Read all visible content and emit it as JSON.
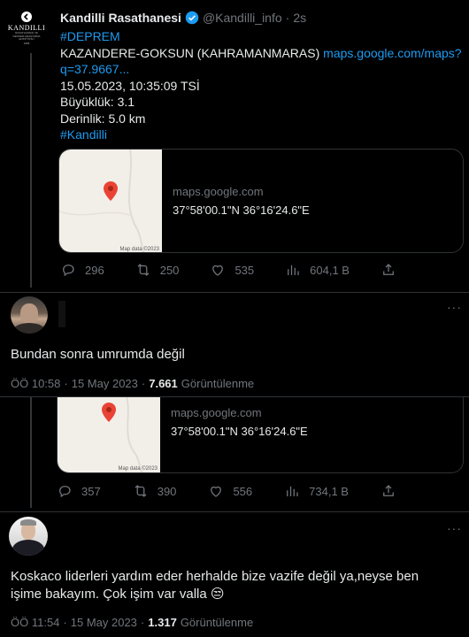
{
  "tweet1": {
    "display_name": "Kandilli Rasathanesi",
    "handle": "@Kandilli_info",
    "sep": "·",
    "time": "2s",
    "logo_text": "KANDILLI",
    "logo_subtext": "RASATHANESİ VE DEPREM ARAŞTIRMA ENSTİTÜSÜ",
    "logo_year": "1868",
    "hashtag1": "#DEPREM",
    "line_location": "KAZANDERE-GOKSUN (KAHRAMANMARAS)",
    "line_location_link": "maps.google.com/maps?",
    "line_link_cont": "q=37.9667...",
    "line_datetime": "15.05.2023, 10:35:09 TSİ",
    "line_magnitude": "Büyüklük: 3.1",
    "line_depth": "Derinlik: 5.0 km",
    "hashtag2": "#Kandilli",
    "card": {
      "domain": "maps.google.com",
      "coords": "37°58'00.1\"N 36°16'24.6\"E",
      "map_credit": "Map data ©2023"
    },
    "actions": {
      "reply": "296",
      "retweet": "250",
      "like": "535",
      "views": "604,1 B"
    }
  },
  "reply1": {
    "text": "Bundan sonra umrumda değil",
    "time": "ÖÖ 10:58",
    "dot": "·",
    "date": "15 May 2023",
    "views": "7.661",
    "views_label": "Görüntülenme",
    "more": "···"
  },
  "tweet2": {
    "card": {
      "domain": "maps.google.com",
      "coords": "37°58'00.1\"N 36°16'24.6\"E",
      "map_credit": "Map data ©2023"
    },
    "actions": {
      "reply": "357",
      "retweet": "390",
      "like": "556",
      "views": "734,1 B"
    }
  },
  "reply2": {
    "text_line1": "Koskaco liderleri yardım eder herhalde bize vazife değil ya,neyse ben",
    "text_line2": "işime bakayım. Çok işim var valla 😒",
    "time": "ÖÖ 11:54",
    "dot": "·",
    "date": "15 May 2023",
    "views": "1.317",
    "views_label": "Görüntülenme",
    "more": "···"
  },
  "colors": {
    "accent": "#1d9bf0",
    "muted": "#71767b",
    "background": "#000000",
    "text": "#e7e9ea",
    "pin": "#ea4335"
  }
}
